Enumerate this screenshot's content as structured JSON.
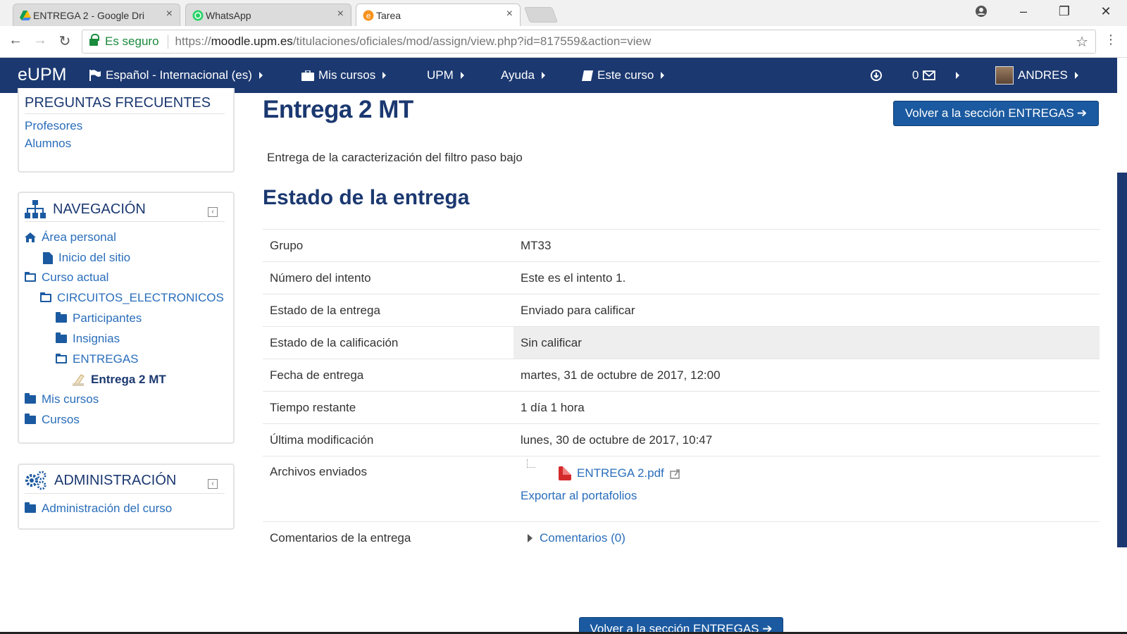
{
  "browser": {
    "tabs": [
      {
        "title": "ENTREGA 2 - Google Dri",
        "close": "×",
        "icon": "google-drive-icon"
      },
      {
        "title": "WhatsApp",
        "close": "×",
        "icon": "whatsapp-icon"
      },
      {
        "title": "Tarea",
        "close": "×",
        "icon": "moodle-icon"
      }
    ],
    "secure_label": "Es seguro",
    "url_scheme": "https://",
    "url_domain": "moodle.upm.es",
    "url_path": "/titulaciones/oficiales/mod/assign/view.php?id=817559&action=view"
  },
  "navbar": {
    "brand": "eUPM",
    "language": "Español - Internacional (es)",
    "mis_cursos": "Mis cursos",
    "upm": "UPM",
    "ayuda": "Ayuda",
    "este_curso": "Este curso",
    "messages_count": "0",
    "user": "ANDRES"
  },
  "faq_block": {
    "title": "PREGUNTAS FRECUENTES",
    "links": [
      "Profesores",
      "Alumnos"
    ]
  },
  "nav_block": {
    "title": "NAVEGACIÓN",
    "items": [
      {
        "label": "Área personal",
        "icon": "home-icon"
      },
      {
        "label": "Inicio del sitio",
        "icon": "page-icon"
      },
      {
        "label": "Curso actual",
        "icon": "folder-open-icon"
      },
      {
        "label": "CIRCUITOS_ELECTRONICOS",
        "icon": "folder-open-icon"
      },
      {
        "label": "Participantes",
        "icon": "folder-icon"
      },
      {
        "label": "Insignias",
        "icon": "folder-icon"
      },
      {
        "label": "ENTREGAS",
        "icon": "folder-open-icon"
      },
      {
        "label": "Entrega 2 MT",
        "icon": "assignment-icon"
      },
      {
        "label": "Mis cursos",
        "icon": "folder-icon"
      },
      {
        "label": "Cursos",
        "icon": "folder-icon"
      }
    ]
  },
  "admin_block": {
    "title": "ADMINISTRACIÓN",
    "items": [
      {
        "label": "Administración del curso",
        "icon": "folder-icon"
      }
    ]
  },
  "main": {
    "title": "Entrega 2 MT",
    "back_button": "Volver a la sección ENTREGAS",
    "intro": "Entrega de la caracterización del filtro paso bajo",
    "section_title": "Estado de la entrega",
    "rows": [
      {
        "label": "Grupo",
        "value": "MT33"
      },
      {
        "label": "Número del intento",
        "value": "Este es el intento 1."
      },
      {
        "label": "Estado de la entrega",
        "value": "Enviado para calificar"
      },
      {
        "label": "Estado de la calificación",
        "value": "Sin calificar"
      },
      {
        "label": "Fecha de entrega",
        "value": "martes, 31 de octubre de 2017, 12:00"
      },
      {
        "label": "Tiempo restante",
        "value": "1 día 1 hora"
      },
      {
        "label": "Última modificación",
        "value": "lunes, 30 de octubre de 2017, 10:47"
      }
    ],
    "files_label": "Archivos enviados",
    "file_name": "ENTREGA 2.pdf",
    "export_link": "Exportar al portafolios",
    "comments_label": "Comentarios de la entrega",
    "comments_link": "Comentarios (0)"
  }
}
